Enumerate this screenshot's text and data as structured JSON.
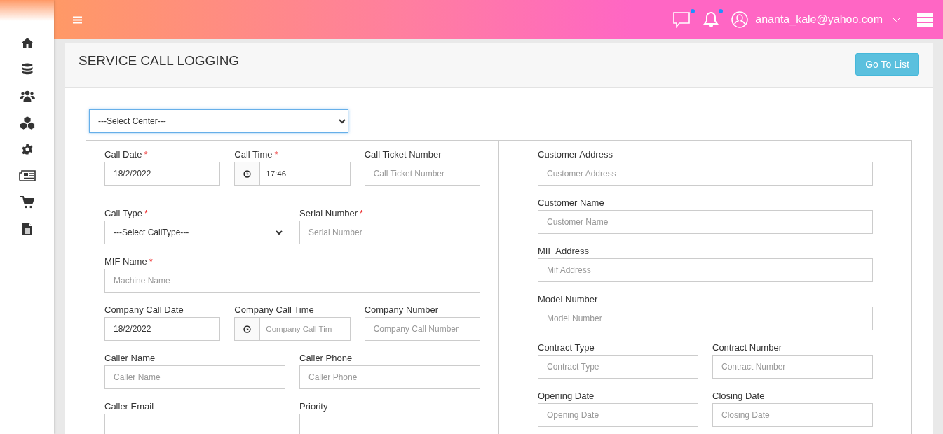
{
  "topbar": {
    "user_email": "ananta_kale@yahoo.com",
    "messages_badge": true,
    "notifications_badge": true
  },
  "page": {
    "title": "SERVICE CALL LOGGING",
    "button": "Go To List"
  },
  "center_select": {
    "value": "---Select Center---"
  },
  "left_rows": [
    {
      "fields": [
        {
          "label": "Call Date",
          "mark": "*",
          "kind": "text",
          "value": "18/2/2022"
        },
        {
          "label": "Call Time",
          "mark": "*",
          "kind": "time",
          "value": "17:46"
        },
        {
          "label": "Call Ticket Number",
          "kind": "text",
          "placeholder": "Call Ticket Number"
        }
      ]
    },
    {
      "fields": [
        {
          "label": "Call Type",
          "mark": "*",
          "kind": "select",
          "value": "---Select CallType---"
        },
        {
          "label": "Serial Number",
          "mark": "*",
          "kind": "text",
          "placeholder": "Serial Number"
        }
      ]
    },
    {
      "fields": [
        {
          "label": "MIF Name",
          "mark": "*",
          "kind": "text",
          "placeholder": "Machine Name"
        }
      ]
    },
    {
      "fields": [
        {
          "label": "Company Call Date",
          "kind": "text",
          "value": "18/2/2022"
        },
        {
          "label": "Company Call Time",
          "kind": "time",
          "placeholder": "Company Call Tim"
        },
        {
          "label": "Company Number",
          "kind": "text",
          "placeholder": "Company Call Number"
        }
      ]
    },
    {
      "fields": [
        {
          "label": "Caller Name",
          "kind": "text",
          "placeholder": "Caller Name"
        },
        {
          "label": "Caller Phone",
          "kind": "text",
          "placeholder": "Caller Phone"
        }
      ]
    },
    {
      "fields": [
        {
          "label": "Caller Email",
          "kind": "text"
        },
        {
          "label": "Priority",
          "kind": "text"
        }
      ]
    }
  ],
  "right_rows": [
    {
      "fields": [
        {
          "label": "Customer Address",
          "kind": "text",
          "placeholder": "Customer Address"
        }
      ]
    },
    {
      "fields": [
        {
          "label": "Customer Name",
          "kind": "text",
          "placeholder": "Customer Name"
        }
      ]
    },
    {
      "fields": [
        {
          "label": "MIF Address",
          "kind": "text",
          "placeholder": "Mif Address"
        }
      ]
    },
    {
      "fields": [
        {
          "label": "Model Number",
          "kind": "text",
          "placeholder": "Model Number"
        }
      ]
    },
    {
      "fields": [
        {
          "label": "Contract Type",
          "kind": "text",
          "placeholder": "Contract Type"
        },
        {
          "label": "Contract Number",
          "kind": "text",
          "placeholder": "Contract Number"
        }
      ]
    },
    {
      "fields": [
        {
          "label": "Opening Date",
          "kind": "text",
          "placeholder": "Opening Date"
        },
        {
          "label": "Closing Date",
          "kind": "text",
          "placeholder": "Closing Date"
        }
      ]
    }
  ]
}
